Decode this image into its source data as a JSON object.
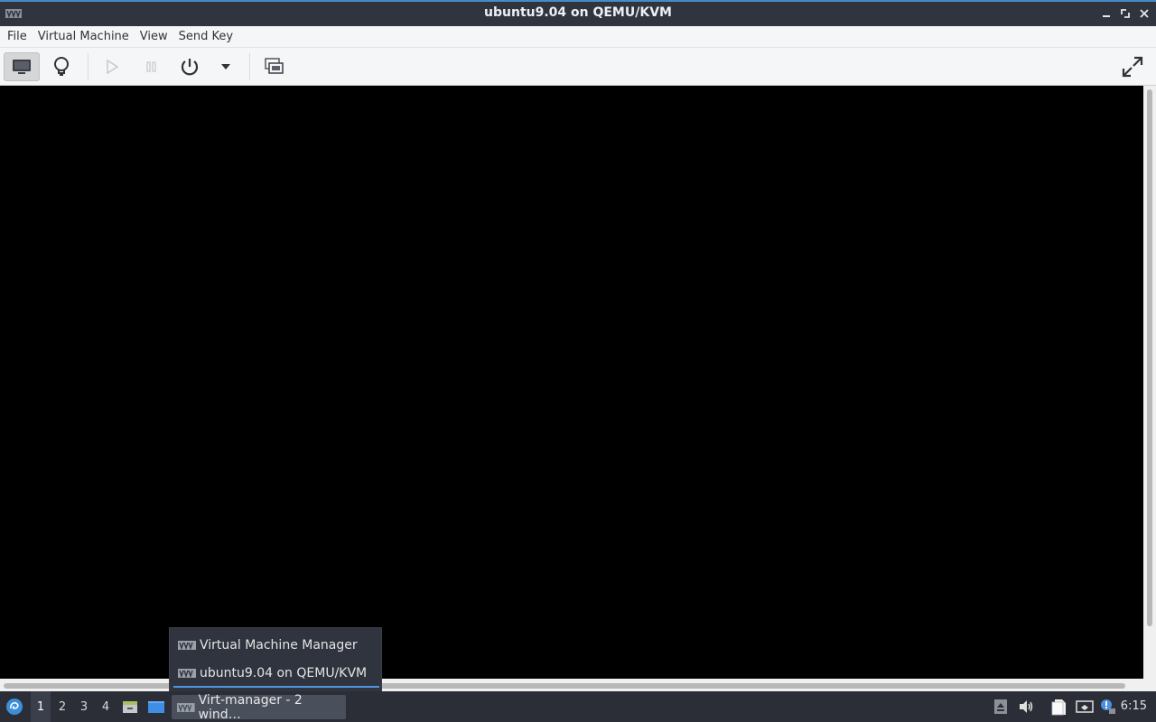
{
  "window": {
    "title": "ubuntu9.04 on QEMU/KVM",
    "minimize_icon": "minimize-icon",
    "maximize_icon": "maximize-icon",
    "close_icon": "close-icon",
    "accent": "#4a8ac4"
  },
  "menubar": {
    "items": [
      "File",
      "Virtual Machine",
      "View",
      "Send Key"
    ]
  },
  "toolbar": {
    "buttons": [
      {
        "name": "show-console",
        "icon": "monitor-icon",
        "active": true
      },
      {
        "name": "show-details",
        "icon": "lightbulb-icon"
      },
      {
        "name": "run",
        "icon": "play-icon",
        "disabled": true
      },
      {
        "name": "pause",
        "icon": "pause-icon",
        "disabled": true
      },
      {
        "name": "shutdown",
        "icon": "power-icon"
      },
      {
        "name": "shutdown-menu",
        "icon": "dropdown-arrow-icon"
      },
      {
        "name": "snapshots",
        "icon": "snapshots-icon"
      },
      {
        "name": "fullscreen",
        "icon": "fullscreen-icon"
      }
    ]
  },
  "popup": {
    "items": [
      {
        "label": "Virtual Machine Manager",
        "selected": false
      },
      {
        "label": "ubuntu9.04 on QEMU/KVM",
        "selected": true
      }
    ]
  },
  "taskbar": {
    "workspaces": [
      "1",
      "2",
      "3",
      "4"
    ],
    "current_workspace": "1",
    "task_label": "Virt-manager - 2 wind…",
    "clock": "6:15"
  }
}
